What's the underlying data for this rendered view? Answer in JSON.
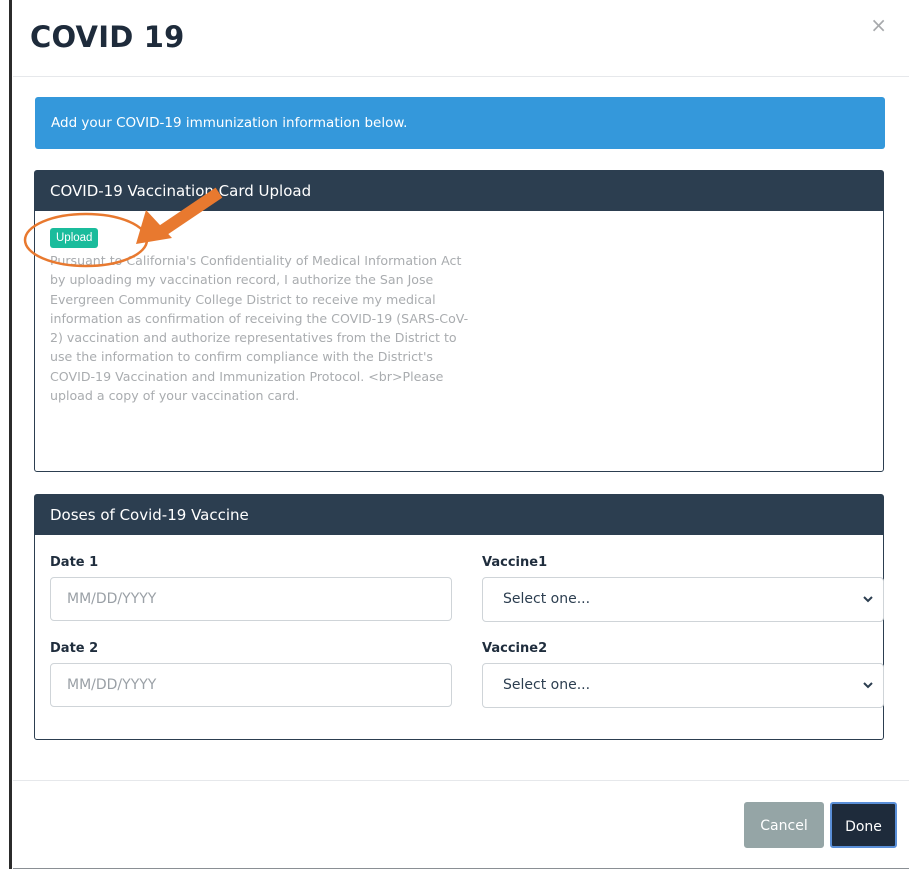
{
  "modal": {
    "title": "COVID 19",
    "close_glyph": "×",
    "banner": "Add your COVID-19 immunization information below.",
    "upload_panel": {
      "heading": "COVID-19 Vaccination Card Upload",
      "button_label": "Upload",
      "text": "Pursuant to California's Confidentiality of Medical Information Act by uploading my vaccination record, I authorize the San Jose Evergreen Community College District to receive my medical information as confirmation of receiving the COVID-19 (SARS-CoV-2) vaccination and authorize representatives from the District to use the information to confirm compliance with the District's COVID-19 Vaccination and Immunization Protocol. <br>Please upload a copy of your vaccination card."
    },
    "doses_panel": {
      "heading": "Doses of Covid-19 Vaccine",
      "date1_label": "Date 1",
      "date1_placeholder": "MM/DD/YYYY",
      "vaccine1_label": "Vaccine1",
      "vaccine1_selected": "Select one...",
      "date2_label": "Date 2",
      "date2_placeholder": "MM/DD/YYYY",
      "vaccine2_label": "Vaccine2",
      "vaccine2_selected": "Select one..."
    },
    "footer": {
      "cancel_label": "Cancel",
      "done_label": "Done"
    }
  },
  "colors": {
    "banner": "#3498db",
    "panel_heading": "#2c3e50",
    "upload_button": "#1abc9c",
    "cancel_button": "#95a5a6",
    "done_button": "#1e2b3b",
    "annotation": "#e8792f"
  },
  "icons": {
    "close": "close-icon",
    "chevron": "chevron-down-icon",
    "annotation_arrow": "arrow-icon"
  }
}
